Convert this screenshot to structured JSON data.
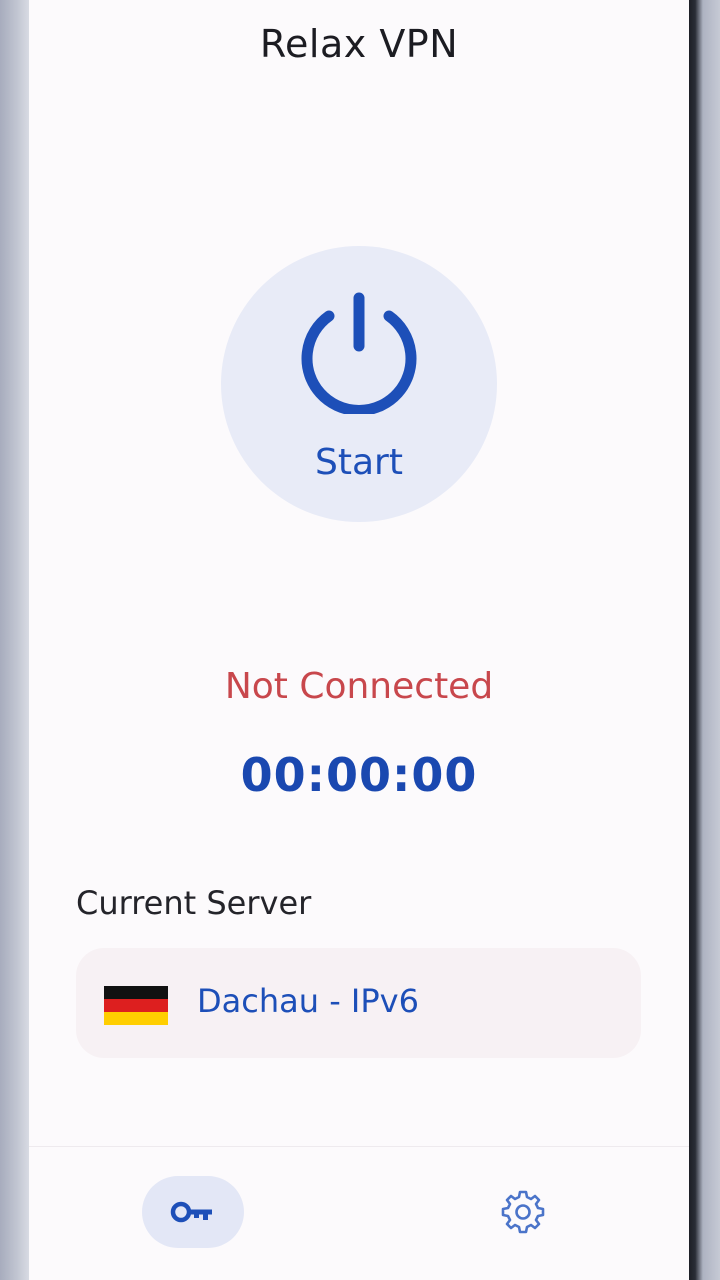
{
  "app": {
    "title": "Relax VPN"
  },
  "connect_button": {
    "label": "Start",
    "icon": "power-icon"
  },
  "status": {
    "text": "Not Connected",
    "timer": "00:00:00"
  },
  "server": {
    "section_label": "Current Server",
    "name": "Dachau - IPv6",
    "flag": "germany-flag-icon"
  },
  "bottom_nav": {
    "items": [
      {
        "icon": "key-icon",
        "active": true
      },
      {
        "icon": "gear-icon",
        "active": false
      }
    ]
  },
  "colors": {
    "accent": "#1d4fb8",
    "status_error": "#c8474c",
    "background": "#fcfafc",
    "button_bg": "#e8ebf7",
    "card_bg": "#f7f1f4"
  }
}
